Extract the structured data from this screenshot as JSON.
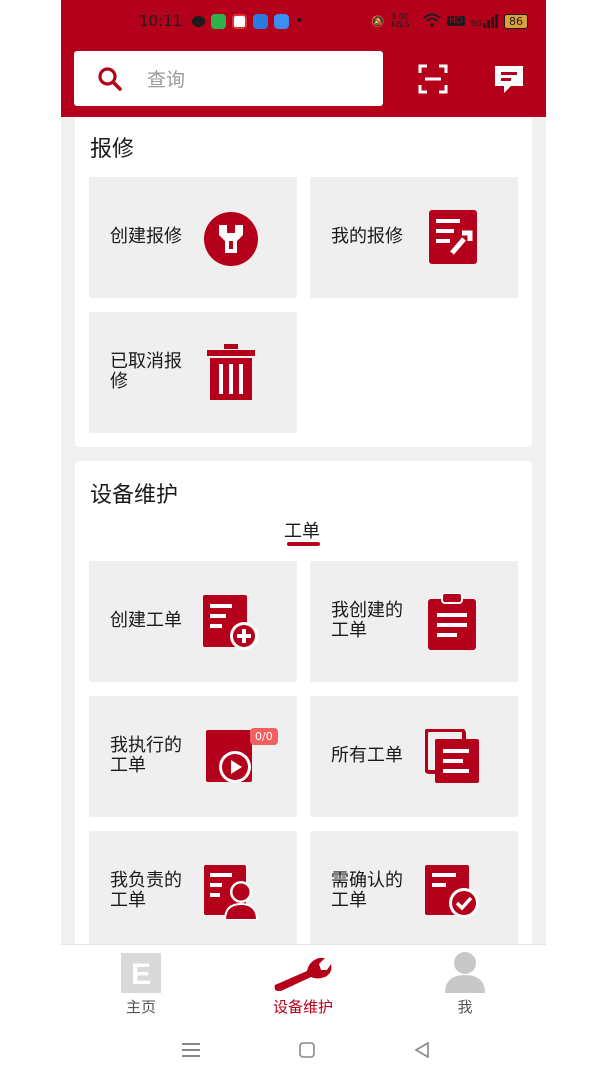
{
  "status_bar": {
    "time": "10:11",
    "network_speed": "3.00 KB/S",
    "hd": "HD",
    "signal": "5G",
    "battery": "86"
  },
  "header": {
    "search_placeholder": "查询",
    "accent_color": "#b5001b"
  },
  "repair_section": {
    "title": "报修",
    "tiles": [
      {
        "label": "创建报修",
        "icon": "wrench-circle-icon"
      },
      {
        "label": "我的报修",
        "icon": "document-wrench-icon"
      },
      {
        "label": "已取消报修",
        "icon": "trash-icon"
      }
    ]
  },
  "maintenance_section": {
    "title": "设备维护",
    "tab": "工单",
    "tiles": [
      {
        "label": "创建工单",
        "icon": "document-plus-icon"
      },
      {
        "label": "我创建的工单",
        "icon": "clipboard-icon"
      },
      {
        "label": "我执行的工单",
        "icon": "play-document-icon",
        "badge": "0/0"
      },
      {
        "label": "所有工单",
        "icon": "documents-stack-icon"
      },
      {
        "label": "我负责的工单",
        "icon": "document-person-icon"
      },
      {
        "label": "需确认的工单",
        "icon": "document-check-icon"
      }
    ]
  },
  "bottom_nav": {
    "items": [
      {
        "label": "主页",
        "icon": "home-e-icon",
        "active": false
      },
      {
        "label": "设备维护",
        "icon": "wrench-icon",
        "active": true
      },
      {
        "label": "我",
        "icon": "person-icon",
        "active": false
      }
    ]
  }
}
